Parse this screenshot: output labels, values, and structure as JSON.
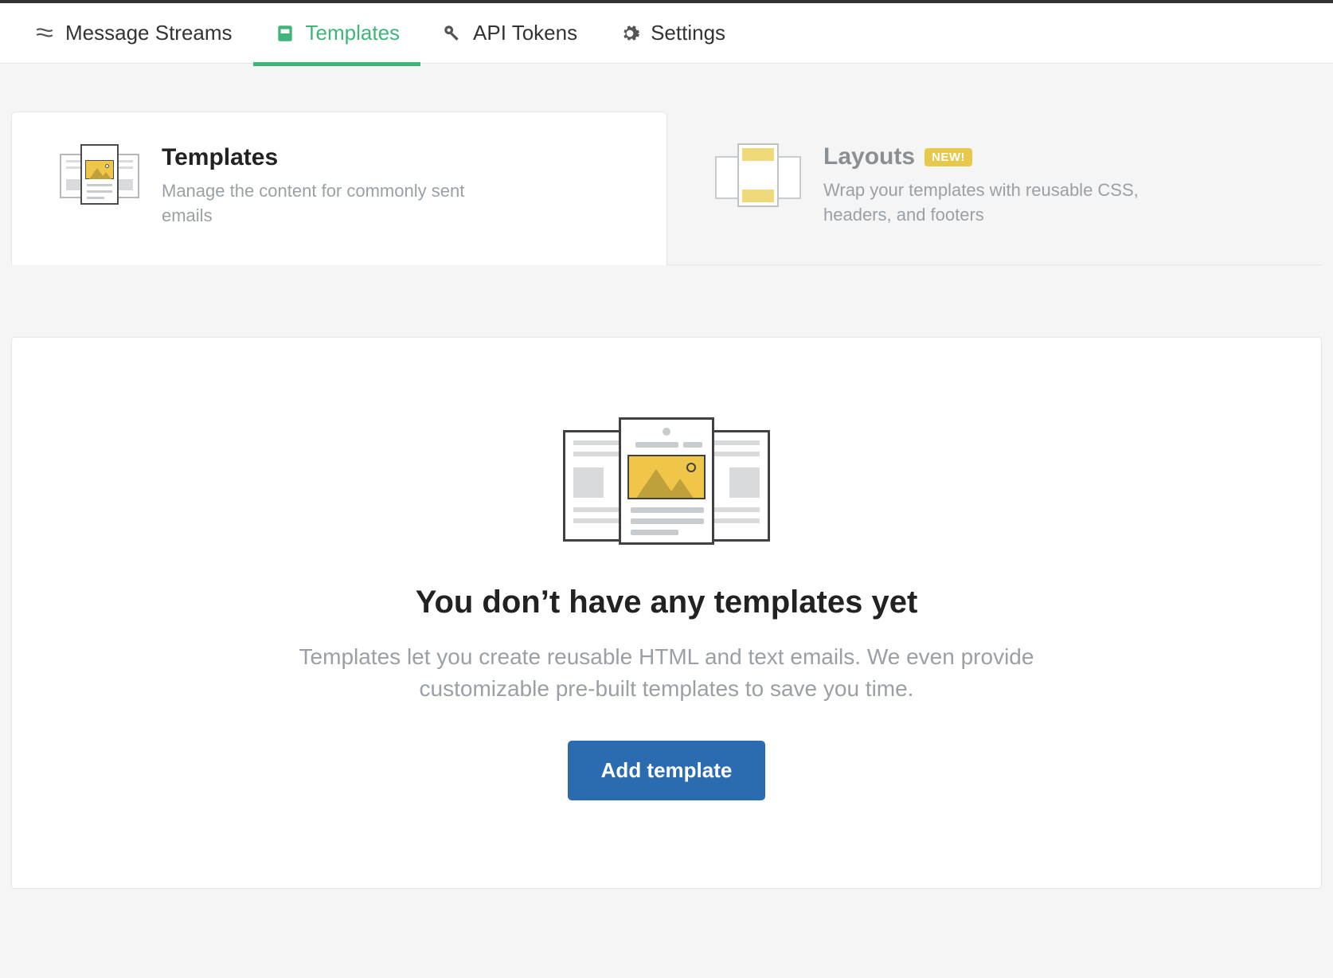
{
  "nav": {
    "items": [
      {
        "label": "Message Streams",
        "icon": "streams"
      },
      {
        "label": "Templates",
        "icon": "templates",
        "active": true
      },
      {
        "label": "API Tokens",
        "icon": "key"
      },
      {
        "label": "Settings",
        "icon": "gear"
      }
    ]
  },
  "sub_tabs": {
    "templates": {
      "title": "Templates",
      "desc": "Manage the content for commonly sent emails"
    },
    "layouts": {
      "title": "Layouts",
      "badge": "NEW!",
      "desc": "Wrap your templates with reusable CSS, headers, and footers"
    }
  },
  "empty_state": {
    "title": "You don’t have any templates yet",
    "desc": "Templates let you create reusable HTML and text emails. We even provide customizable pre-built templates to save you time.",
    "button": "Add template"
  },
  "colors": {
    "accent_green": "#3fb57a",
    "primary_blue": "#2b6cb0",
    "badge_yellow": "#e6c94a"
  }
}
